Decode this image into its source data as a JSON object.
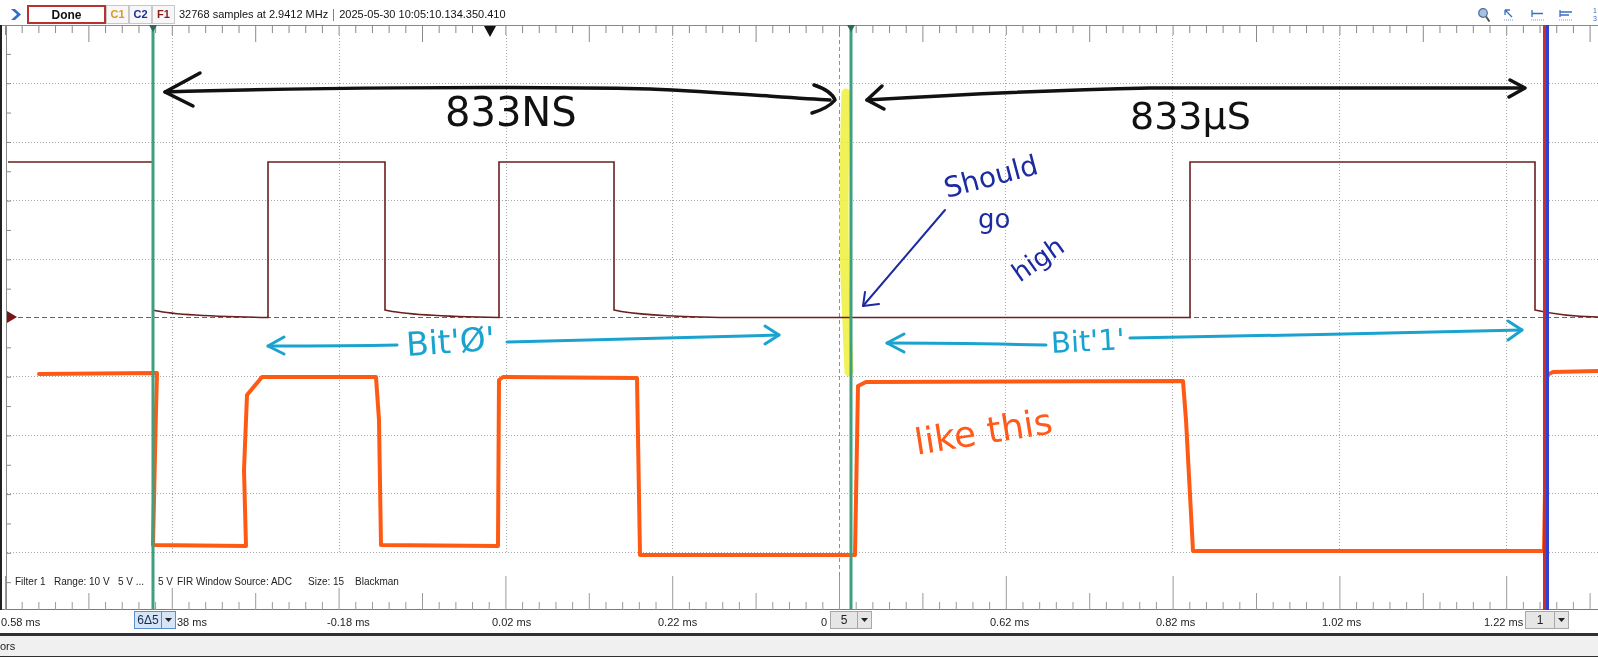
{
  "toolbar": {
    "status_button": "Done",
    "channels": [
      {
        "label": "C1",
        "color": "#d89a1c"
      },
      {
        "label": "C2",
        "color": "#1f2c9c"
      },
      {
        "label": "F1",
        "color": "#8b1c1c"
      }
    ],
    "sample_info": "32768 samples at 2.9412 MHz",
    "timestamp": "2025-05-30 10:05:10.134.350.410",
    "edge_digits": [
      "1",
      "3"
    ]
  },
  "plot": {
    "annotations": [
      {
        "text": "833NS",
        "color": "#111111"
      },
      {
        "text": "833µS",
        "color": "#111111"
      },
      {
        "text": "Bit'Ø'",
        "color": "#1aa3cf"
      },
      {
        "text": "Bit'1'",
        "color": "#1aa3cf"
      },
      {
        "text": "Should",
        "color": "#1c2ca0"
      },
      {
        "text": "go",
        "color": "#1c2ca0"
      },
      {
        "text": "high",
        "color": "#1c2ca0"
      },
      {
        "text": "like this",
        "color": "#ff5a1a"
      }
    ],
    "filter_info": [
      "Filter 1",
      "Range: 10 V",
      "5 V ...",
      "5 V",
      "FIR Window Source: ADC",
      "Size: 15",
      "Blackman"
    ]
  },
  "time_axis": {
    "labels": [
      "0.58 ms",
      "38 ms",
      "-0.18 ms",
      "0.02 ms",
      "0.22 ms",
      "0",
      "0.62 ms",
      "0.82 ms",
      "1.02 ms",
      "1.22 ms"
    ],
    "cursors": [
      {
        "label": "6Δ5",
        "selected": true
      },
      {
        "label": "5",
        "selected": false
      },
      {
        "label": "1",
        "selected": false
      }
    ]
  },
  "bottom_panel": {
    "label": "ors"
  }
}
